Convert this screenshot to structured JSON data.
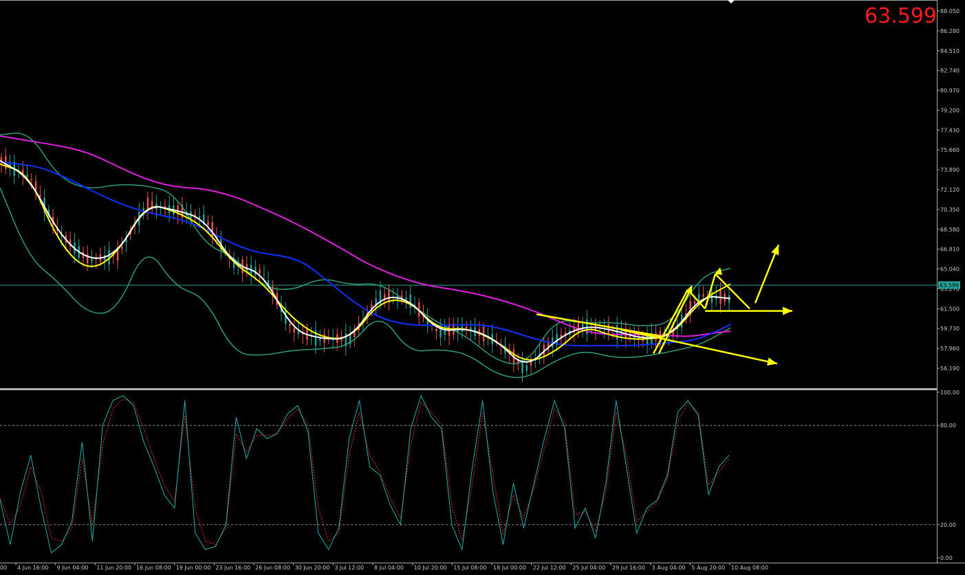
{
  "current_price": "63.599",
  "price_tag": "63.599",
  "chart_data": [
    {
      "type": "line",
      "panel": "price",
      "y_ticks": [
        "88.050",
        "86.280",
        "84.510",
        "82.740",
        "80.970",
        "79.200",
        "77.430",
        "75.660",
        "73.890",
        "72.120",
        "70.350",
        "68.580",
        "66.810",
        "65.040",
        "63.270",
        "61.500",
        "59.730",
        "57.960",
        "56.190"
      ],
      "ylim": [
        55.2,
        88.7
      ],
      "current_value": 63.599,
      "x_labels": [
        "4 Jun 16:00",
        "9 Jun 04:00",
        "11 Jun 20:00",
        "16 Jun 08:00",
        "19 Jun 00:00",
        "23 Jun 16:00",
        "26 Jun 08:00",
        "30 Jun 20:00",
        "3 Jul 12:00",
        "8 Jul 04:00",
        "10 Jul 20:00",
        "15 Jul 08:00",
        "18 Jul 00:00",
        "22 Jul 12:00",
        "25 Jul 04:00",
        "29 Jul 16:00",
        "3 Aug 04:00",
        "5 Aug 20:00",
        "10 Aug 08:00"
      ],
      "x_label_first_partial": "00",
      "colors": {
        "bollinger": "#2e9e78",
        "ma_slow": "#e020e0",
        "ma_mid": "#1030ff",
        "ma_fast": "#ffff00",
        "ma_white": "#ffffff",
        "candle_up": "#26a69a",
        "candle_down": "#ef5350",
        "annotation": "#ffff00",
        "price_line": "#26a69a"
      },
      "series": [
        {
          "values": [
            76.9,
            76.6,
            76.3,
            76.0,
            75.6,
            74.9,
            74.0,
            73.2,
            72.6,
            72.3,
            72.2,
            71.8,
            71.2,
            70.4,
            69.6,
            68.7,
            67.7,
            66.7,
            65.6,
            64.8,
            64.1,
            63.6,
            63.3,
            63.0,
            62.6,
            62.1,
            61.5,
            60.8,
            60.0,
            59.4,
            59.2,
            59.2,
            59.2,
            59.1,
            59.0,
            59.3,
            59.5
          ]
        },
        {
          "values": [
            74.6,
            74.4,
            74.1,
            73.4,
            72.5,
            71.6,
            70.8,
            70.2,
            69.8,
            69.4,
            68.7,
            67.7,
            66.9,
            66.4,
            66.2,
            65.6,
            64.2,
            62.7,
            61.4,
            60.5,
            60.1,
            60.0,
            60.0,
            60.1,
            60.0,
            59.6,
            59.0,
            58.5,
            58.2,
            58.2,
            58.2,
            58.2,
            58.3,
            58.5,
            58.6,
            59.2,
            60.1
          ]
        },
        {
          "values": [
            74.7,
            73.2,
            68.2,
            65.8,
            66.3,
            70.8,
            70.3,
            69.5,
            65.4,
            64.7,
            59.6,
            58.8,
            58.8,
            62.6,
            62.4,
            59.4,
            59.8,
            58.7,
            56.1,
            58.7,
            60.0,
            59.6,
            58.8,
            59.1,
            62.7,
            62.4
          ]
        },
        {
          "values": [
            74.4,
            73.5,
            67.4,
            64.8,
            66.3,
            70.9,
            70.2,
            68.8,
            65.5,
            63.8,
            60.6,
            58.9,
            58.8,
            62.2,
            62.3,
            59.6,
            59.8,
            58.6,
            56.6,
            57.6,
            60.0,
            59.0,
            58.7,
            59.1,
            62.3,
            63.7
          ]
        },
        {
          "values": [
            77.0,
            77.3,
            73.2,
            72.1,
            72.6,
            72.5,
            71.8,
            67.2,
            66.2,
            63.4,
            63.1,
            64.3,
            63.6,
            63.8,
            62.0,
            60.2,
            59.0,
            56.8,
            56.4,
            60.6,
            60.2,
            60.3,
            59.9,
            60.2,
            64.5,
            65.1
          ]
        },
        {
          "values": [
            72.3,
            66.0,
            63.9,
            61.0,
            61.2,
            67.3,
            63.4,
            62.6,
            57.5,
            57.3,
            57.8,
            57.9,
            58.2,
            61.2,
            57.6,
            57.9,
            57.5,
            55.6,
            55.2,
            56.9,
            57.8,
            57.1,
            57.2,
            57.7,
            58.3,
            59.8
          ]
        }
      ]
    },
    {
      "type": "line",
      "panel": "stochastic",
      "y_ticks": [
        "100.00",
        "80.00",
        "20.00",
        "0.00"
      ],
      "ylim": [
        0,
        100
      ],
      "levels": [
        80,
        20
      ],
      "colors": {
        "main": "#20b2aa",
        "signal": "#e03030",
        "level": "#8a8a8a"
      },
      "series": [
        {
          "values": [
            35,
            8,
            40,
            62,
            30,
            3,
            8,
            22,
            70,
            10,
            80,
            95,
            98,
            92,
            70,
            55,
            38,
            30,
            95,
            15,
            5,
            7,
            20,
            85,
            60,
            78,
            72,
            75,
            87,
            92,
            76,
            15,
            5,
            18,
            72,
            95,
            55,
            50,
            32,
            20,
            78,
            98,
            85,
            78,
            20,
            5,
            55,
            95,
            40,
            8,
            45,
            18,
            45,
            72,
            95,
            78,
            18,
            30,
            12,
            45,
            95,
            55,
            15,
            30,
            35,
            50,
            88,
            95,
            86,
            38,
            55,
            62
          ]
        },
        {
          "values": [
            36,
            20,
            32,
            55,
            40,
            12,
            10,
            18,
            60,
            20,
            68,
            90,
            96,
            94,
            78,
            60,
            44,
            34,
            86,
            30,
            10,
            8,
            18,
            75,
            64,
            74,
            74,
            75,
            84,
            90,
            80,
            30,
            10,
            15,
            62,
            88,
            62,
            52,
            36,
            24,
            68,
            94,
            88,
            80,
            32,
            10,
            45,
            88,
            50,
            14,
            38,
            24,
            42,
            66,
            90,
            82,
            26,
            28,
            16,
            40,
            88,
            62,
            22,
            28,
            34,
            48,
            82,
            94,
            88,
            44,
            52,
            60
          ]
        }
      ]
    }
  ]
}
